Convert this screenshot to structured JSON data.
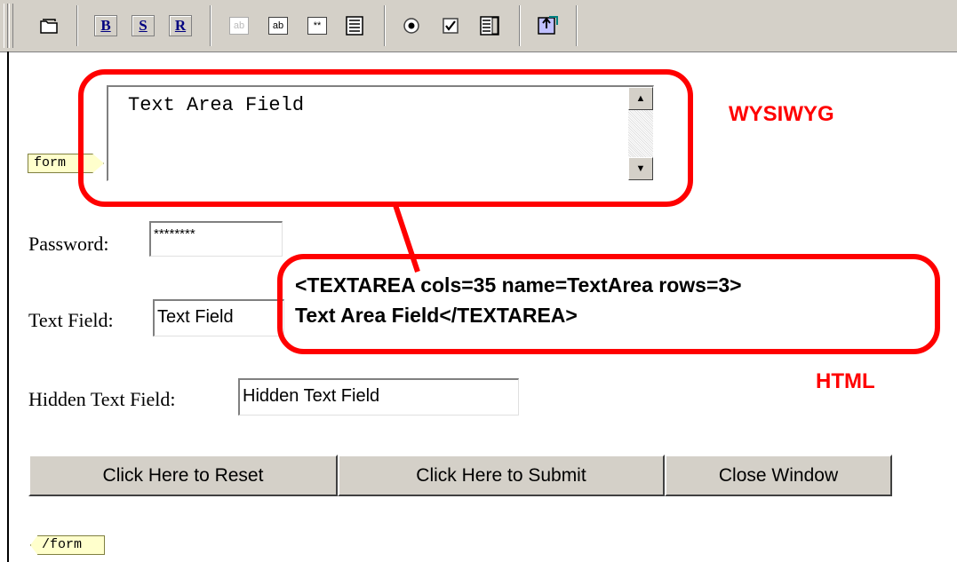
{
  "toolbar": {
    "buttons": [
      {
        "name": "open-icon",
        "glyph": "🗀"
      },
      {
        "name": "bold-button",
        "label": "B"
      },
      {
        "name": "strike-button",
        "label": "S"
      },
      {
        "name": "r-button",
        "label": "R"
      },
      {
        "name": "hidden-field-icon",
        "label": "ab"
      },
      {
        "name": "text-field-icon",
        "label": "ab"
      },
      {
        "name": "password-field-icon",
        "label": "**"
      },
      {
        "name": "textarea-icon",
        "glyph": "≣"
      },
      {
        "name": "radio-icon",
        "glyph": "◉"
      },
      {
        "name": "checkbox-icon",
        "glyph": "☑"
      },
      {
        "name": "listbox-icon",
        "glyph": "▤"
      },
      {
        "name": "submit-icon",
        "glyph": "⬆"
      }
    ]
  },
  "form": {
    "open_tag": "form",
    "close_tag": "/form",
    "textarea_value": "Text Area Field",
    "password_label": "Password:",
    "password_value": "********",
    "text_label": "Text Field:",
    "text_value": "Text Field",
    "hidden_label": "Hidden Text Field:",
    "hidden_value": "Hidden Text Field",
    "reset_label": "Click Here to Reset",
    "submit_label": "Click Here to Submit",
    "close_label": "Close Window"
  },
  "annotations": {
    "wysiwyg": "WYSIWYG",
    "html_label": "HTML",
    "code_line1": "<TEXTAREA cols=35 name=TextArea rows=3>",
    "code_line2": "Text Area Field</TEXTAREA>",
    "accent_color": "#ff0000"
  }
}
